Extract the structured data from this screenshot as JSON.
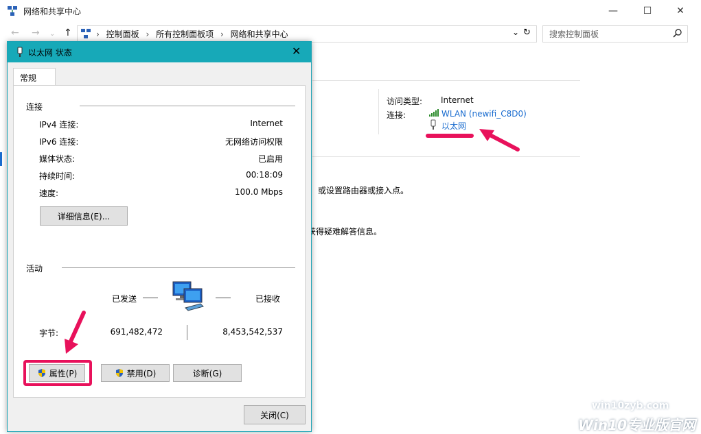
{
  "window": {
    "title": "网络和共享中心",
    "minimize": "—",
    "maximize": "☐",
    "close": "✕"
  },
  "address": {
    "crumbs": [
      "控制面板",
      "所有控制面板项",
      "网络和共享中心"
    ],
    "separator": "›",
    "search_placeholder": "搜索控制面板"
  },
  "network_info": {
    "access_type_label": "访问类型:",
    "access_type_value": "Internet",
    "connection_label": "连接:",
    "wlan_link": "WLAN (newifi_C8D0)",
    "ethernet_link": "以太网"
  },
  "background_text": {
    "line1": "或设置路由器或接入点。",
    "line2": "获得疑难解答信息。"
  },
  "dialog": {
    "title": "以太网 状态",
    "close": "✕",
    "tab": "常规",
    "connection_group": "连接",
    "rows": [
      {
        "label": "IPv4 连接:",
        "value": "Internet"
      },
      {
        "label": "IPv6 连接:",
        "value": "无网络访问权限"
      },
      {
        "label": "媒体状态:",
        "value": "已启用"
      },
      {
        "label": "持续时间:",
        "value": "00:18:09"
      },
      {
        "label": "速度:",
        "value": "100.0 Mbps"
      }
    ],
    "details_button": "详细信息(E)...",
    "activity_group": "活动",
    "sent_label": "已发送",
    "received_label": "已接收",
    "bytes_label": "字节:",
    "bytes_sent": "691,482,472",
    "bytes_received": "8,453,542,537",
    "properties_button": "属性(P)",
    "disable_button": "禁用(D)",
    "diagnose_button": "诊断(G)",
    "close_button": "关闭(C)"
  },
  "watermark": {
    "url": "win10zyb.com",
    "brand": "Win10专业版官网"
  },
  "colors": {
    "dialog_title": "#17a9b8",
    "link": "#1a6ccf",
    "annotation": "#e8115b"
  }
}
